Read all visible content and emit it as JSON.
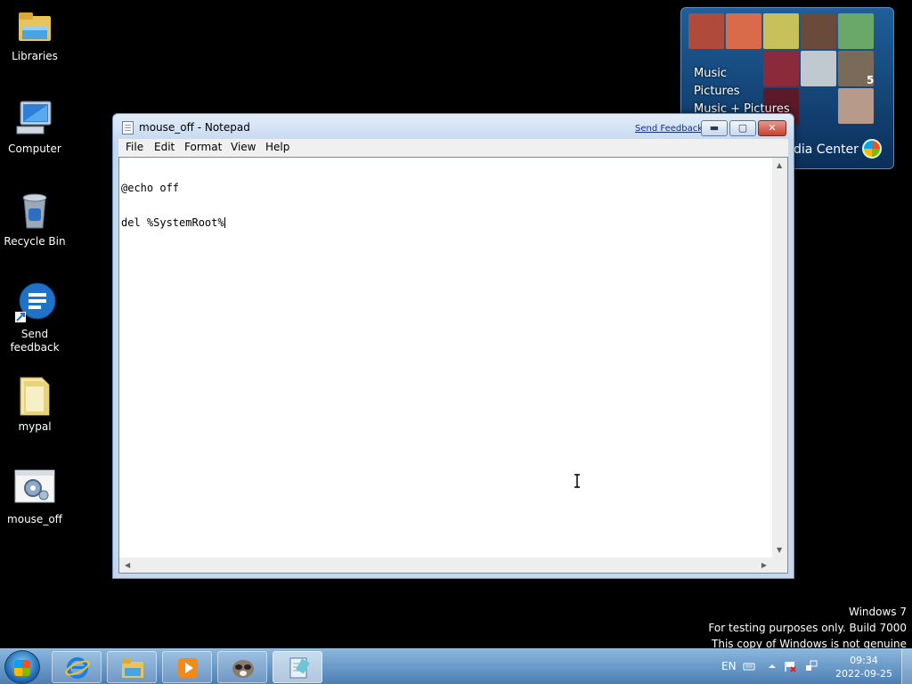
{
  "desktop": {
    "icons": [
      {
        "label": "Libraries",
        "icon": "libraries-icon"
      },
      {
        "label": "Computer",
        "icon": "computer-icon"
      },
      {
        "label": "Recycle Bin",
        "icon": "recycle-bin-icon"
      },
      {
        "label": "Send\nfeedback",
        "icon": "send-feedback-icon"
      },
      {
        "label": "mypal",
        "icon": "folder-icon"
      },
      {
        "label": "mouse_off",
        "icon": "batch-file-icon"
      }
    ]
  },
  "media_center": {
    "menu": [
      "Music",
      "Pictures",
      "Music + Pictures"
    ],
    "name": "dia Center",
    "tile_badge": "5"
  },
  "notepad": {
    "title": "mouse_off - Notepad",
    "send_feedback": "Send Feedback",
    "menu": [
      "File",
      "Edit",
      "Format",
      "View",
      "Help"
    ],
    "lines": [
      "@echo off",
      "del %SystemRoot%"
    ]
  },
  "watermark": {
    "line1": "Windows 7",
    "line2": "For testing purposes only. Build 7000",
    "line3": "This copy of Windows is not genuine"
  },
  "taskbar": {
    "items": [
      "internet-explorer-icon",
      "windows-explorer-icon",
      "media-player-icon",
      "mypal-icon",
      "notepad-icon"
    ],
    "tray": {
      "language": "EN",
      "time": "09:34",
      "date": "2022-09-25"
    }
  }
}
